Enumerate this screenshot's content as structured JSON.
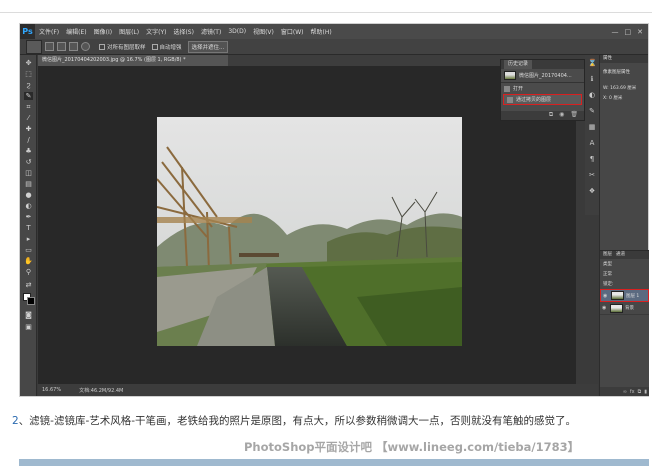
{
  "menubar": {
    "logo": "Ps",
    "items": [
      "文件(F)",
      "编辑(E)",
      "图像(I)",
      "图层(L)",
      "文字(Y)",
      "选择(S)",
      "滤镜(T)",
      "3D(D)",
      "视图(V)",
      "窗口(W)",
      "帮助(H)"
    ],
    "controls": [
      "—",
      "□",
      "✕"
    ]
  },
  "options": {
    "sample_all_layers": "对所有图层取样",
    "auto_enhance": "自动增强",
    "select_subject": "选择并遮住..."
  },
  "document": {
    "tab_title": "微信图片_20170404202003.jpg @ 16.7% (图层 1, RGB/8) *",
    "zoom": "16.67%",
    "doc_size": "文档:46.2M/92.4M"
  },
  "history_panel": {
    "tabs": [
      "历史记录"
    ],
    "snapshot_label": "微信图片_20170404...",
    "steps": [
      "打开",
      "通过拷贝的图层"
    ]
  },
  "properties_panel": {
    "tab": "属性",
    "title": "像素图层属性",
    "w_label": "W: 163.69 厘米",
    "x_label": "X: 0 厘米"
  },
  "layers_panel": {
    "tabs": [
      "图层",
      "通道"
    ],
    "kind": "类型",
    "mode": "正常",
    "lock": "锁定:",
    "layers": [
      {
        "name": "图层 1",
        "selected": true
      },
      {
        "name": "背景",
        "selected": false
      }
    ]
  },
  "caption": {
    "number": "2",
    "text": "、滤镜-滤镜库-艺术风格-干笔画，老铁给我的照片是原图，有点大，所以参数稍微调大一点，否则就没有笔触的感觉了。"
  },
  "watermark": "PhotoShop平面设计吧 【www.lineeg.com/tieba/1783】",
  "colors": {
    "highlight": "#d92020",
    "ps_blue": "#31a8ff",
    "link_blue": "#2a6ab0"
  }
}
